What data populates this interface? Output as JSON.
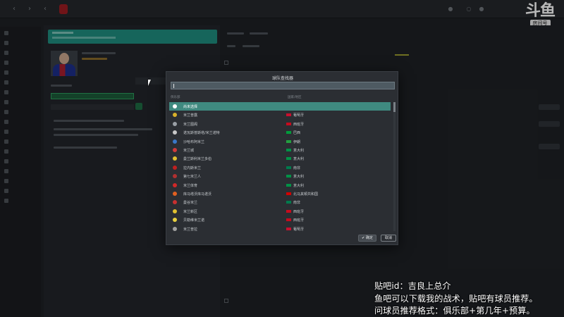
{
  "logo": {
    "glyph": "斗鱼",
    "tag": "房间号",
    "room_number": "10710570"
  },
  "dialog": {
    "title": "球队查找器",
    "search": {
      "value": "",
      "placeholder": ""
    },
    "columns": {
      "name": "俱乐部",
      "country": "国家/地区"
    },
    "rows": [
      {
        "icon_color": "#ffffff",
        "name": "尚未选择",
        "flag": "",
        "country": "",
        "selected": true
      },
      {
        "icon_color": "#d9b12a",
        "name": "米兰普露",
        "flag": "#c8102e",
        "country": "葡萄牙",
        "selected": false
      },
      {
        "icon_color": "#9aa0a6",
        "name": "米兰图阁",
        "flag": "#c60b1e",
        "country": "西班牙",
        "selected": false
      },
      {
        "icon_color": "#c8c8c8",
        "name": "诺瓦斯普斯塔/米兰诺特",
        "flag": "#009c3b",
        "country": "巴西",
        "selected": false
      },
      {
        "icon_color": "#3a78c8",
        "name": "沙哈布阿米兰",
        "flag": "#239f40",
        "country": "伊朗",
        "selected": false
      },
      {
        "icon_color": "#d03a3a",
        "name": "米兰城",
        "flag": "#009246",
        "country": "意大利",
        "selected": false
      },
      {
        "icon_color": "#e0c030",
        "name": "曼兰斯利米兰多伯",
        "flag": "#009246",
        "country": "意大利",
        "selected": false
      },
      {
        "icon_color": "#c02020",
        "name": "拉内斯米兰",
        "flag": "#007a4d",
        "country": "南非",
        "selected": false
      },
      {
        "icon_color": "#b03030",
        "name": "第七米兰人",
        "flag": "#009246",
        "country": "意大利",
        "selected": false
      },
      {
        "icon_color": "#d02828",
        "name": "米兰体育",
        "flag": "#009246",
        "country": "意大利",
        "selected": false
      },
      {
        "icon_color": "#e06020",
        "name": "库马塔沃库马诺沃",
        "flag": "#d20000",
        "country": "北马其顿共和国",
        "selected": false
      },
      {
        "icon_color": "#c83030",
        "name": "曼谷米兰",
        "flag": "#007a4d",
        "country": "南非",
        "selected": false
      },
      {
        "icon_color": "#e0c030",
        "name": "米兰新区",
        "flag": "#c60b1e",
        "country": "西班牙",
        "selected": false
      },
      {
        "icon_color": "#e8d040",
        "name": "贝勒维米兰诺",
        "flag": "#c60b1e",
        "country": "西班牙",
        "selected": false
      },
      {
        "icon_color": "#a0a0a0",
        "name": "米兰普拉",
        "flag": "#c8102e",
        "country": "葡萄牙",
        "selected": false
      }
    ],
    "ok_label": "✔ 确定",
    "cancel_label": "取消"
  },
  "overlay": {
    "line1": "贴吧id：吉良上总介",
    "line2": "鱼吧可以下载我的战术，贴吧有球员推荐。",
    "line3": "问球员推荐格式：俱乐部+第几年+预算。"
  },
  "colors": {
    "accent": "#3f8a80",
    "banner": "#1f8c7f",
    "club": "#9b1c22",
    "background": "#1e2125"
  }
}
